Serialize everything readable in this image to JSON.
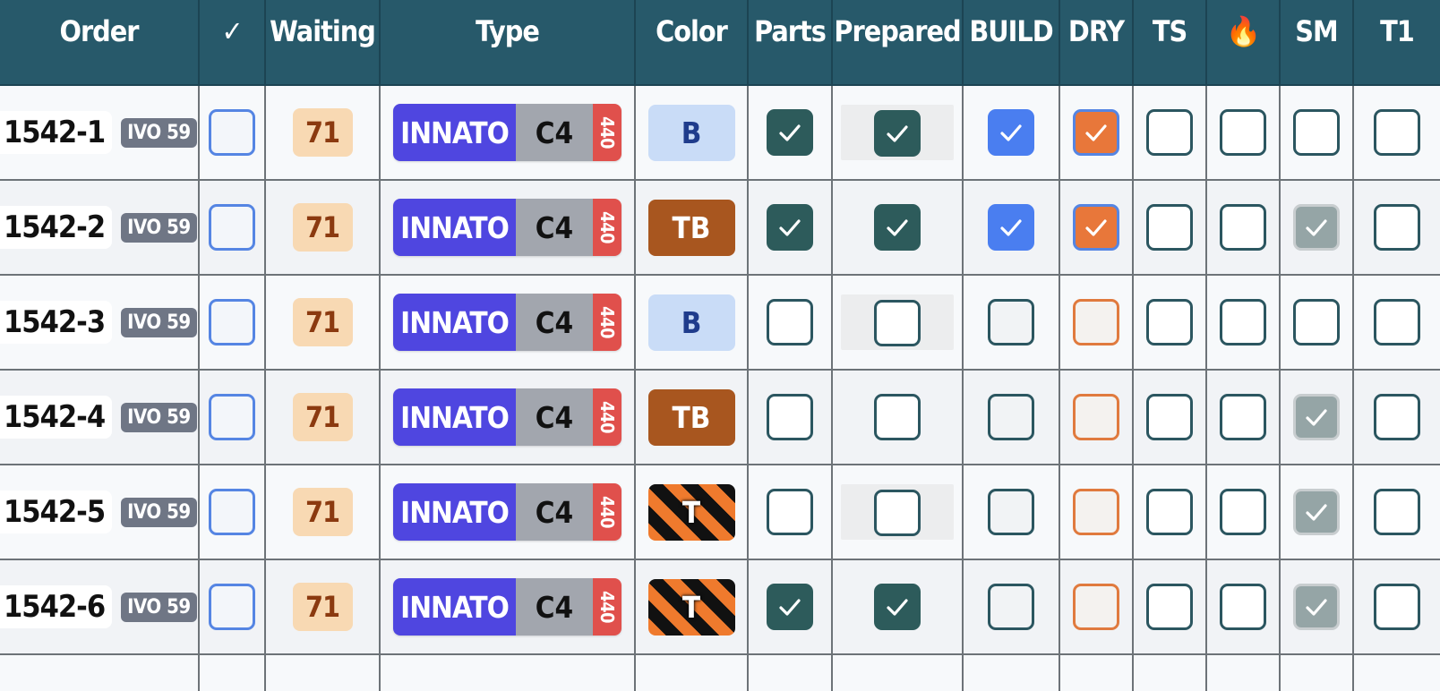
{
  "columns": [
    "Order",
    "✓",
    "Waiting",
    "Type",
    "Color",
    "Parts",
    "Prepared",
    "BUILD",
    "DRY",
    "TS",
    "🔥",
    "SM",
    "T1"
  ],
  "rows": [
    {
      "order": "1542-1",
      "badge": "IVO 59",
      "waiting": "71",
      "type": {
        "name": "INNATO",
        "code": "C4",
        "freq": "440"
      },
      "color": "B",
      "color_variant": "B",
      "checks": {
        "done": false,
        "parts": true,
        "prepared": true,
        "build": true,
        "dry": true,
        "ts": false,
        "fire": false,
        "sm": false,
        "t1": false
      },
      "prep_shaded": true
    },
    {
      "order": "1542-2",
      "badge": "IVO 59",
      "waiting": "71",
      "type": {
        "name": "INNATO",
        "code": "C4",
        "freq": "440"
      },
      "color": "TB",
      "color_variant": "TB",
      "checks": {
        "done": false,
        "parts": true,
        "prepared": true,
        "build": true,
        "dry": true,
        "ts": false,
        "fire": false,
        "sm": true,
        "t1": false
      },
      "prep_shaded": false
    },
    {
      "order": "1542-3",
      "badge": "IVO 59",
      "waiting": "71",
      "type": {
        "name": "INNATO",
        "code": "C4",
        "freq": "440"
      },
      "color": "B",
      "color_variant": "B",
      "checks": {
        "done": false,
        "parts": false,
        "prepared": false,
        "build": false,
        "dry": false,
        "ts": false,
        "fire": false,
        "sm": false,
        "t1": false
      },
      "prep_shaded": true
    },
    {
      "order": "1542-4",
      "badge": "IVO 59",
      "waiting": "71",
      "type": {
        "name": "INNATO",
        "code": "C4",
        "freq": "440"
      },
      "color": "TB",
      "color_variant": "TB",
      "checks": {
        "done": false,
        "parts": false,
        "prepared": false,
        "build": false,
        "dry": false,
        "ts": false,
        "fire": false,
        "sm": true,
        "t1": false
      },
      "prep_shaded": false
    },
    {
      "order": "1542-5",
      "badge": "IVO 59",
      "waiting": "71",
      "type": {
        "name": "INNATO",
        "code": "C4",
        "freq": "440"
      },
      "color": "T",
      "color_variant": "T",
      "checks": {
        "done": false,
        "parts": false,
        "prepared": false,
        "build": false,
        "dry": false,
        "ts": false,
        "fire": false,
        "sm": true,
        "t1": false
      },
      "prep_shaded": true
    },
    {
      "order": "1542-6",
      "badge": "IVO 59",
      "waiting": "71",
      "type": {
        "name": "INNATO",
        "code": "C4",
        "freq": "440"
      },
      "color": "T",
      "color_variant": "T",
      "checks": {
        "done": false,
        "parts": true,
        "prepared": true,
        "build": false,
        "dry": false,
        "ts": false,
        "fire": false,
        "sm": true,
        "t1": false
      },
      "prep_shaded": false
    }
  ],
  "colors": {
    "header_bg": "#27596a",
    "type_name_bg": "#4f46e0",
    "type_code_bg": "#a2a6ae",
    "type_freq_bg": "#e0504c",
    "waiting_bg": "#f8d9b3",
    "badge_bg": "#6f7685",
    "check_dark": "#2d5b5b",
    "check_build": "#4a7ef0",
    "check_dry": "#e8773a",
    "check_sm": "#95a5a6",
    "color_B": "#c9dcf7",
    "color_TB": "#a8561f",
    "stripe_orange": "#ef7a2d",
    "stripe_black": "#111111"
  },
  "icons": {
    "header_check": "check-icon",
    "fire": "fire-icon",
    "checkmark": "checkmark-icon"
  }
}
